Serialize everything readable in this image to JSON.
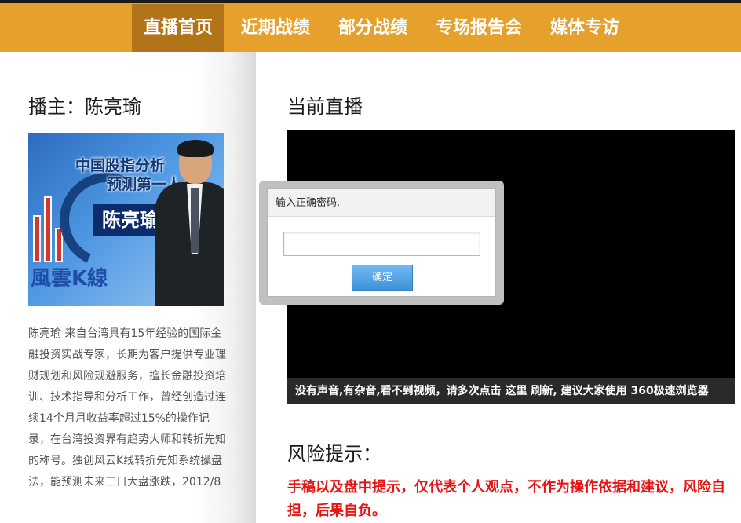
{
  "nav": {
    "items": [
      "直播首页",
      "近期战绩",
      "部分战绩",
      "专场报告会",
      "媒体专访"
    ],
    "active_index": 0
  },
  "sidebar": {
    "title": "播主：陈亮瑜",
    "banner": {
      "line1": "中国股指分析",
      "line2": "预测第一人",
      "name": "陈亮瑜",
      "logo": "風雲K線"
    },
    "bio": "陈亮瑜 来自台湾具有15年经验的国际金融投资实战专家，长期为客户提供专业理财规划和风险规避服务，擅长金融投资培训、技术指导和分析工作，曾经创造过连续14个月月收益率超过15%的操作记录，在台湾投资界有趋势大师和转折先知的称号。独创风云K线转折先知系统操盘法，能预测未来三日大盘涨跌，2012/8"
  },
  "main": {
    "live_title": "当前直播",
    "video_notice": {
      "before": "没有声音,有杂音,看不到视频，请多次点击 ",
      "link1": "这里",
      "mid": " ",
      "link2": "刷新",
      "after": ", 建议大家使用 360极速浏览器"
    },
    "risk_title": "风险提示：",
    "risk_text": "手稿以及盘中提示，仅代表个人观点，不作为操作依据和建议，风险自担，后果自负。"
  },
  "dialog": {
    "title": "输入正确密码.",
    "input_value": "",
    "confirm_label": "确定"
  },
  "colors": {
    "nav_bg": "#e5a12c",
    "nav_active_bg": "#b27418",
    "risk_text": "#e81414",
    "button": "#4a9fe0"
  }
}
